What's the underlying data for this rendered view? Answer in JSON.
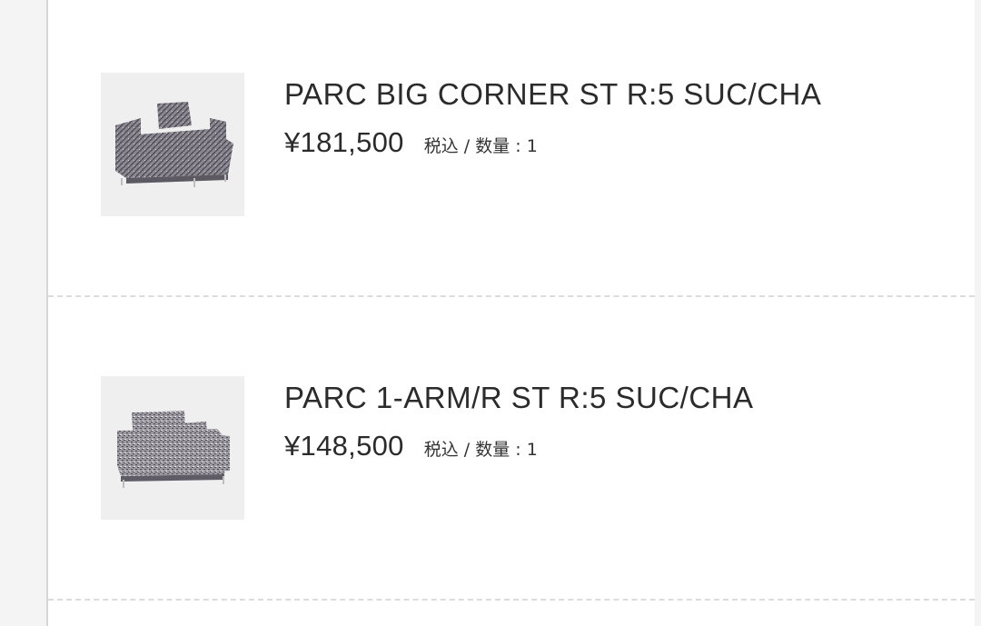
{
  "cart": {
    "items": [
      {
        "name": "PARC BIG CORNER ST R:5 SUC/CHA",
        "price": "¥181,500",
        "tax_note": "税込",
        "separator": " / ",
        "qty_label": "数量",
        "qty_sep": " : ",
        "qty": "1",
        "image_icon": "corner-sofa-image"
      },
      {
        "name": "PARC 1-ARM/R ST R:5 SUC/CHA",
        "price": "¥148,500",
        "tax_note": "税込",
        "separator": " / ",
        "qty_label": "数量",
        "qty_sep": " : ",
        "qty": "1",
        "image_icon": "one-arm-sofa-image"
      }
    ]
  },
  "colors": {
    "panel_bg": "#ffffff",
    "page_bg": "#f1f1f1",
    "thumb_bg": "#efefef",
    "text": "#2b2b2b",
    "divider": "#dcdcdc"
  }
}
